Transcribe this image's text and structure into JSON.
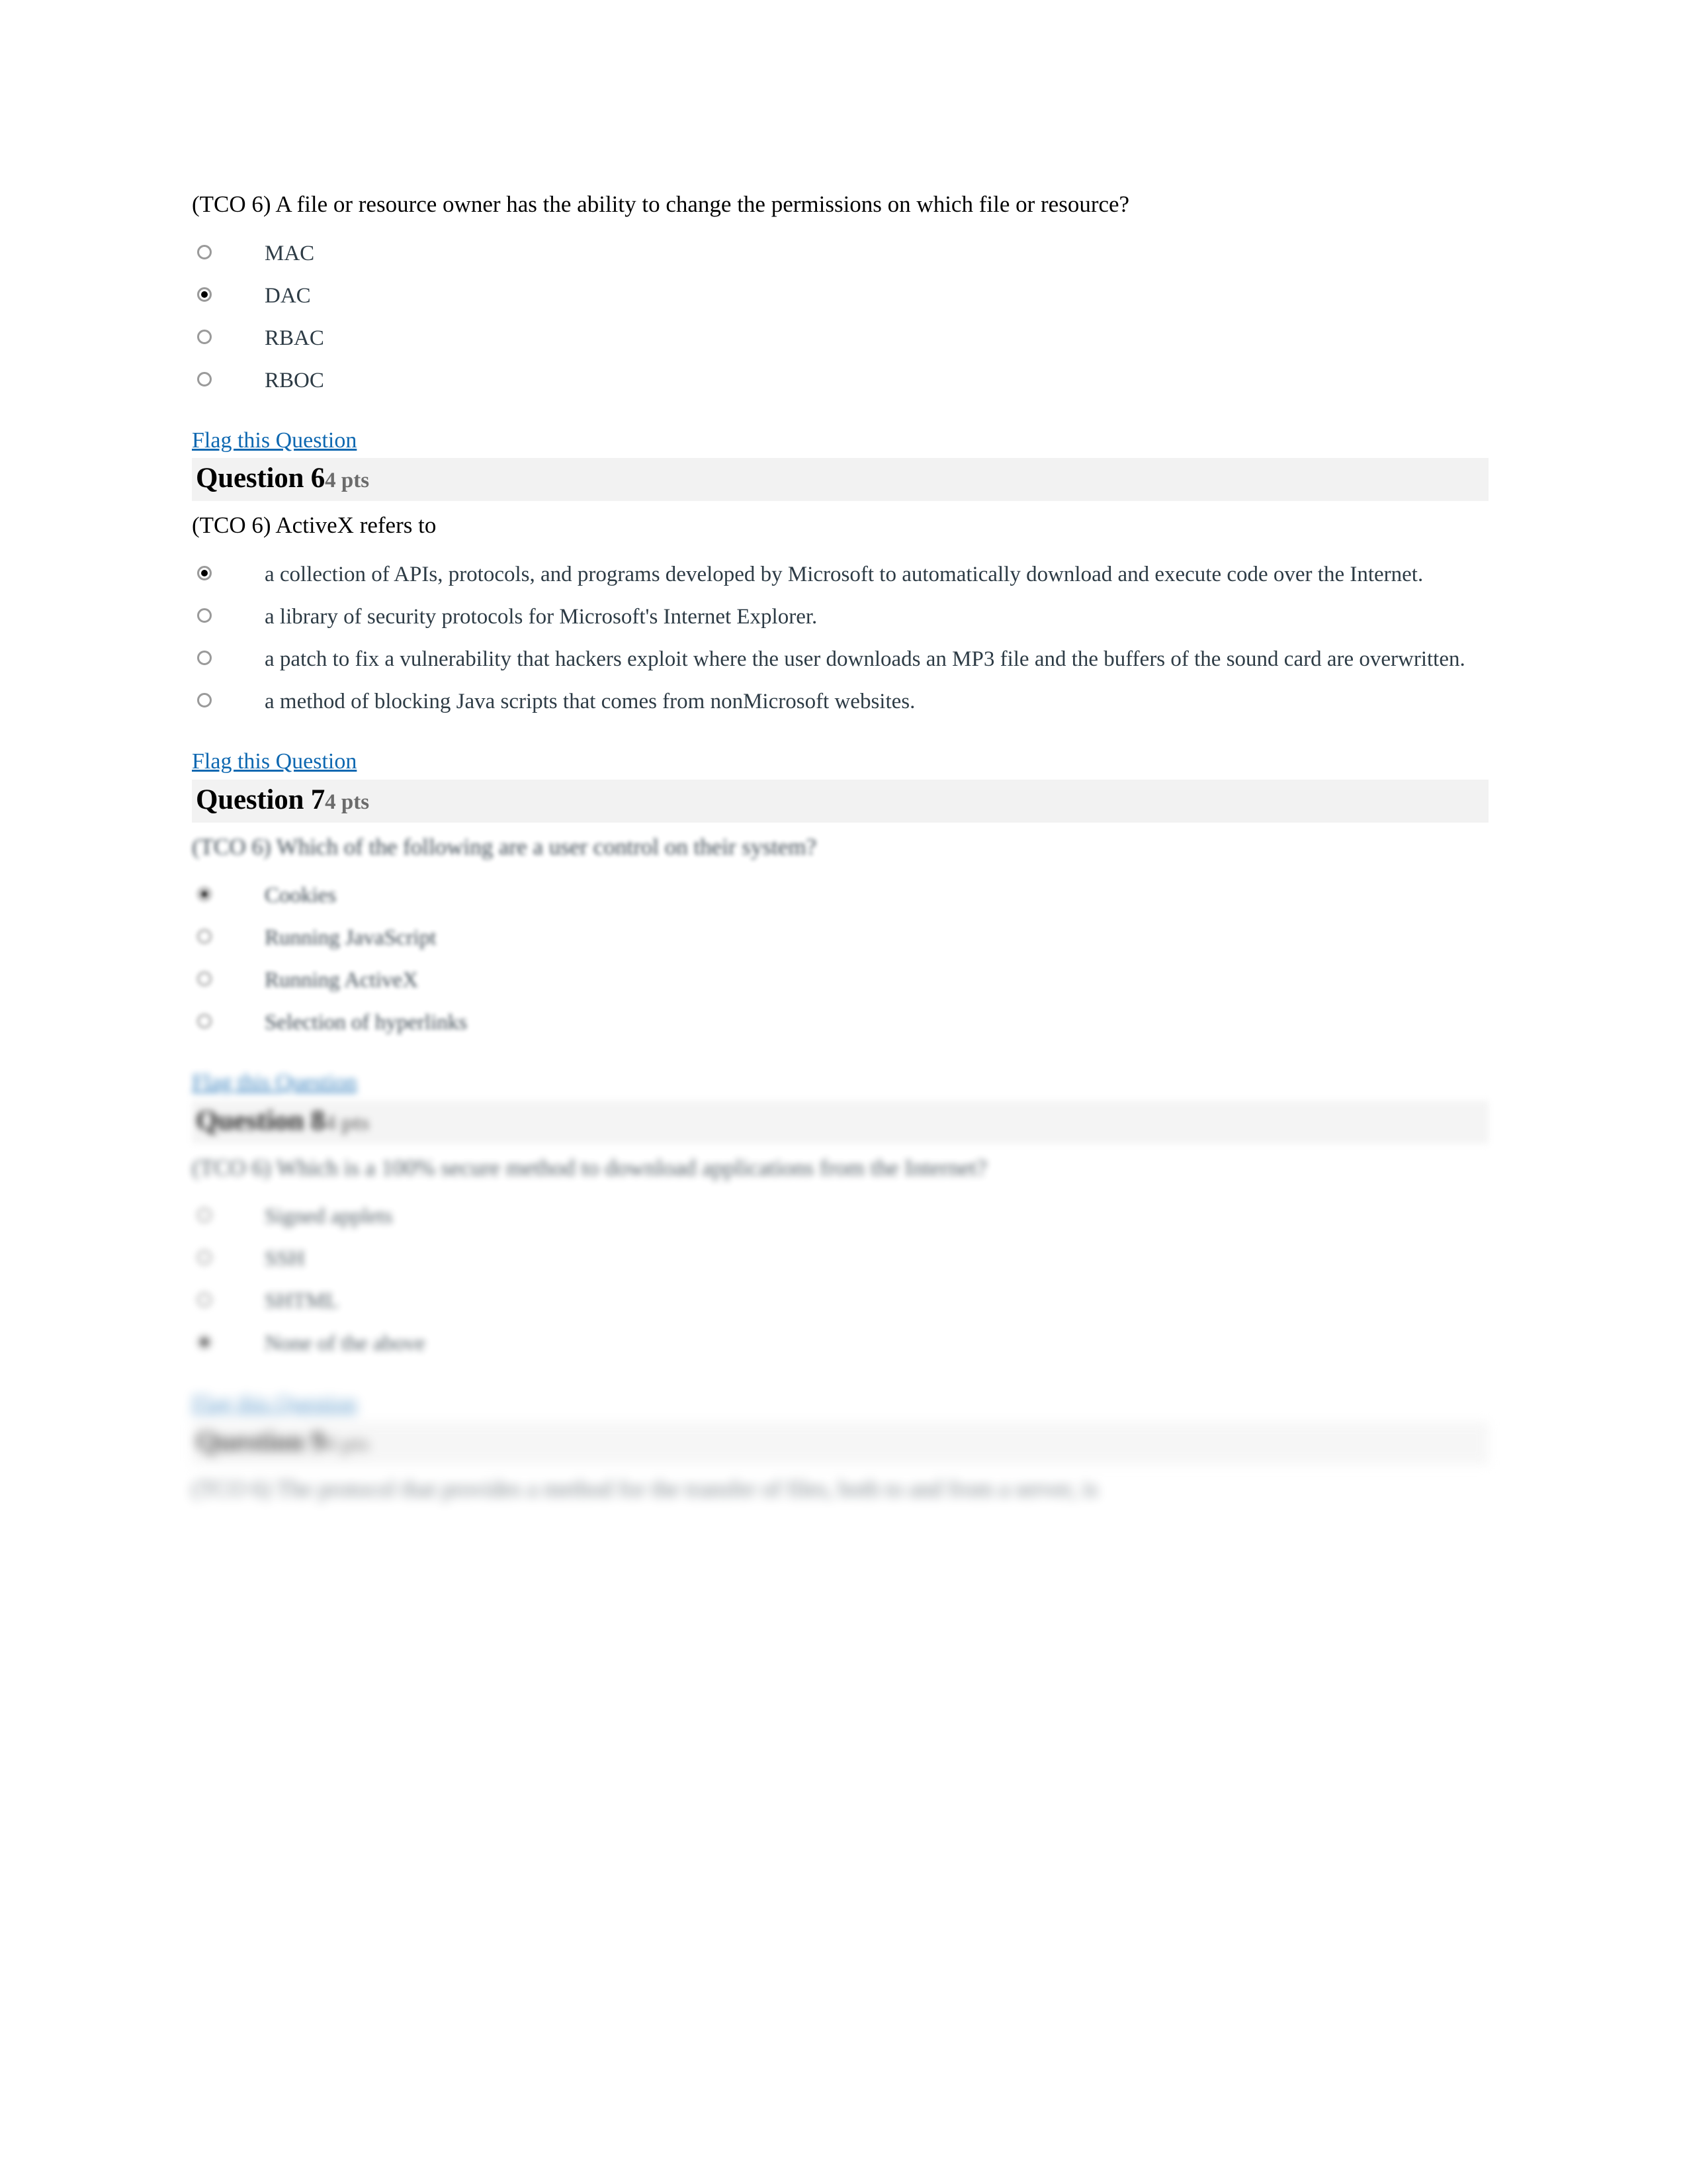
{
  "document": {
    "page_background": "#ffffff",
    "link_color": "#0E68B1",
    "answer_text_color": "#2D3B45",
    "header_band_color": "#F2F2F2",
    "points_color": "#6b6b6b"
  },
  "flag_link_label": "Flag this Question",
  "questions": [
    {
      "id": "q5",
      "has_header": false,
      "prompt": "(TCO 6) A file or resource owner has the ability to change the permissions on which file or resource?",
      "answers": [
        {
          "label": "MAC",
          "selected": false
        },
        {
          "label": "DAC",
          "selected": true
        },
        {
          "label": "RBAC",
          "selected": false
        },
        {
          "label": "RBOC",
          "selected": false
        }
      ]
    },
    {
      "id": "q6",
      "has_header": true,
      "header_name": "Question 6",
      "header_points": "4 pts",
      "prompt": "(TCO 6) ActiveX refers to",
      "answers": [
        {
          "label": "a collection of APIs, protocols, and programs developed by Microsoft to automatically download and execute code over the Internet.",
          "selected": true
        },
        {
          "label": "a library of security protocols for Microsoft's Internet Explorer.",
          "selected": false
        },
        {
          "label": "a patch to fix a vulnerability that hackers exploit where the user downloads an MP3 file and the buffers of the sound card are overwritten.",
          "selected": false
        },
        {
          "label": "a method of blocking Java scripts that comes from nonMicrosoft websites.",
          "selected": false
        }
      ]
    },
    {
      "id": "q7",
      "has_header": true,
      "header_name": "Question 7",
      "header_points": "4 pts",
      "prompt": "(TCO 6) Which of the following are a user control on their system?",
      "answers": [
        {
          "label": "Cookies",
          "selected": true
        },
        {
          "label": "Running JavaScript",
          "selected": false
        },
        {
          "label": "Running ActiveX",
          "selected": false
        },
        {
          "label": "Selection of hyperlinks",
          "selected": false
        }
      ]
    },
    {
      "id": "q8",
      "has_header": true,
      "header_name": "Question 8",
      "header_points": "4 pts",
      "prompt": "(TCO 6) Which is a 100% secure method to download applications from the Internet?",
      "answers": [
        {
          "label": "Signed applets",
          "selected": false
        },
        {
          "label": "SSH",
          "selected": false
        },
        {
          "label": "SHTML",
          "selected": false
        },
        {
          "label": "None of the above",
          "selected": true
        }
      ]
    },
    {
      "id": "q9",
      "has_header": true,
      "header_name": "Question 9",
      "header_points": "4 pts",
      "prompt": "(TCO 6) The protocol that provides a method for the transfer of files, both to and from a server, is",
      "answers": []
    }
  ]
}
